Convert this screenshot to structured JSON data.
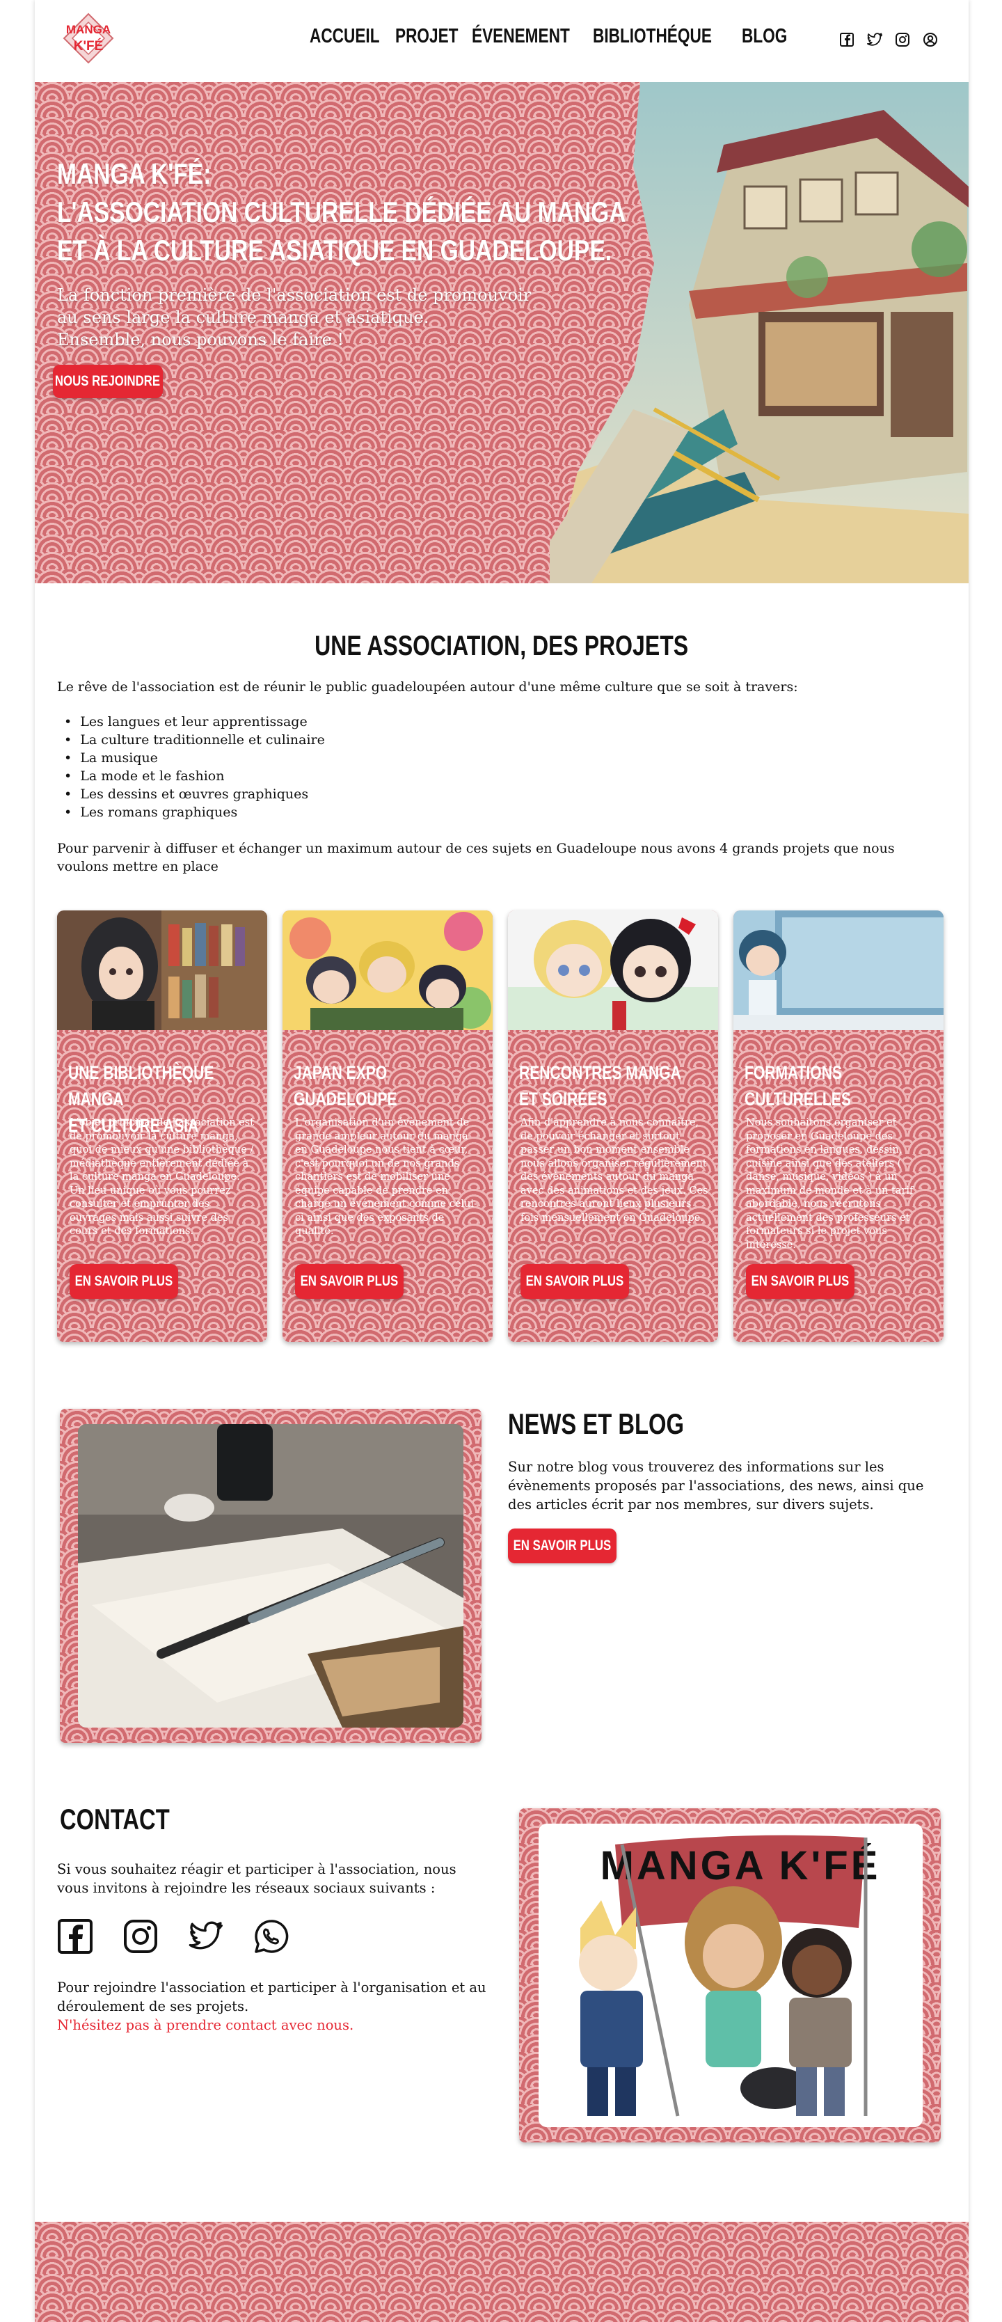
{
  "logo": {
    "line1": "MANGA",
    "line2": "K'FÉ"
  },
  "nav": {
    "items": [
      "ACCUEIL",
      "PROJET",
      "ÉVENEMENT",
      "BIBLIOTHÉQUE",
      "BLOG"
    ]
  },
  "social_icons": [
    "facebook-icon",
    "twitter-icon",
    "instagram-icon",
    "account-icon"
  ],
  "hero": {
    "title_line1": "MANGA K'FÉ:",
    "title_line2": "L'ASSOCIATION CULTURELLE DÉDIÉE AU MANGA",
    "title_line3": "ET À LA CULTURE ASIATIQUE EN GUADELOUPE.",
    "text_line1": "La fonction première de l'association est de promouvoir",
    "text_line2": "au sens large la culture manga et asiatique.",
    "text_line3": "Ensemble, nous pouvons le faire !",
    "button": "NOUS REJOINDRE"
  },
  "projects": {
    "title": "UNE ASSOCIATION, DES PROJETS",
    "intro": "Le rêve de l'association est de réunir le public guadeloupéen autour d'une même culture que se soit à travers:",
    "topics": [
      "Les langues et leur apprentissage",
      "La culture traditionnelle et culinaire",
      "La musique",
      "La mode et le fashion",
      "Les dessins et œuvres graphiques",
      "Les romans graphiques"
    ],
    "outro": "Pour parvenir à diffuser et échanger un maximum autour de ces sujets en Guadeloupe nous avons 4 grands projets que nous voulons mettre en place",
    "cards": [
      {
        "title_line1": "UNE BIBLIOTHÈQUE MANGA",
        "title_line2": "ET CULTURE ASIA",
        "text": "L'objet principal de l'association est de promouvoir la culture manga, quoi de mieux qu'une bibliothèque / médiathèque entièrement dédiée à la culture manga en Guadeloupe. Un lieu unique où vous pourrez consulter et emprunter des ouvrages mais aussi suivre des cours et des formations.",
        "button": "EN SAVOIR PLUS"
      },
      {
        "title_line1": "JAPAN EXPO GUADELOUPE",
        "title_line2": "",
        "text": "L'organisation d'un évènement de grande ampleur autour du manga en Guadeloupe nous tient à cœur, c'est pourquoi un de nos grands chantiers est de mobiliser une équipe capable de prendre en charge un événement comme celui-ci ainsi que des exposants de qualité.",
        "button": "EN SAVOIR PLUS"
      },
      {
        "title_line1": "RENCONTRES MANGA",
        "title_line2": "ET SOIRÉES",
        "text": "Afin d'apprendre à nous connaître, de pouvoir échanger et surtout passer un bon moment ensemble nous allons organiser régulièrement des évènements autour du manga avec des animations et des jeux. Ces rencontres auront lieux plusieurs fois mensuellement en Guadeloupe.",
        "button": "EN SAVOIR PLUS"
      },
      {
        "title_line1": "FORMATIONS CULTURELLES",
        "title_line2": "",
        "text": "Nous souhaitons organiser et proposer en Guadeloupe des formations en langues, dessin, cuisine ainsi que des ateliers ( danse, musique, vidéos ) à un maximum de monde et à un tarif abordable, nous recrutons actuellement des professeurs et formateurs si le projet vous intéresse.",
        "button": "EN SAVOIR PLUS"
      }
    ]
  },
  "news": {
    "title": "NEWS ET BLOG",
    "text": "Sur notre blog vous trouverez des informations sur les évènements proposés par l'associations, des news, ainsi que des articles écrit par nos membres, sur divers sujets.",
    "button": "EN SAVOIR PLUS"
  },
  "contact": {
    "title": "CONTACT",
    "text": "Si vous souhaitez réagir et participer à l'association, nous vous invitons à rejoindre les réseaux sociaux suivants :",
    "icons": [
      "facebook-icon",
      "instagram-icon",
      "twitter-icon",
      "whatsapp-icon"
    ],
    "text2": "Pour rejoindre l'association et participer à l'organisation et au déroulement de ses projets.",
    "link": "N'hésitez pas à  prendre contact avec nous.",
    "banner": "MANGA K'FÉ"
  }
}
